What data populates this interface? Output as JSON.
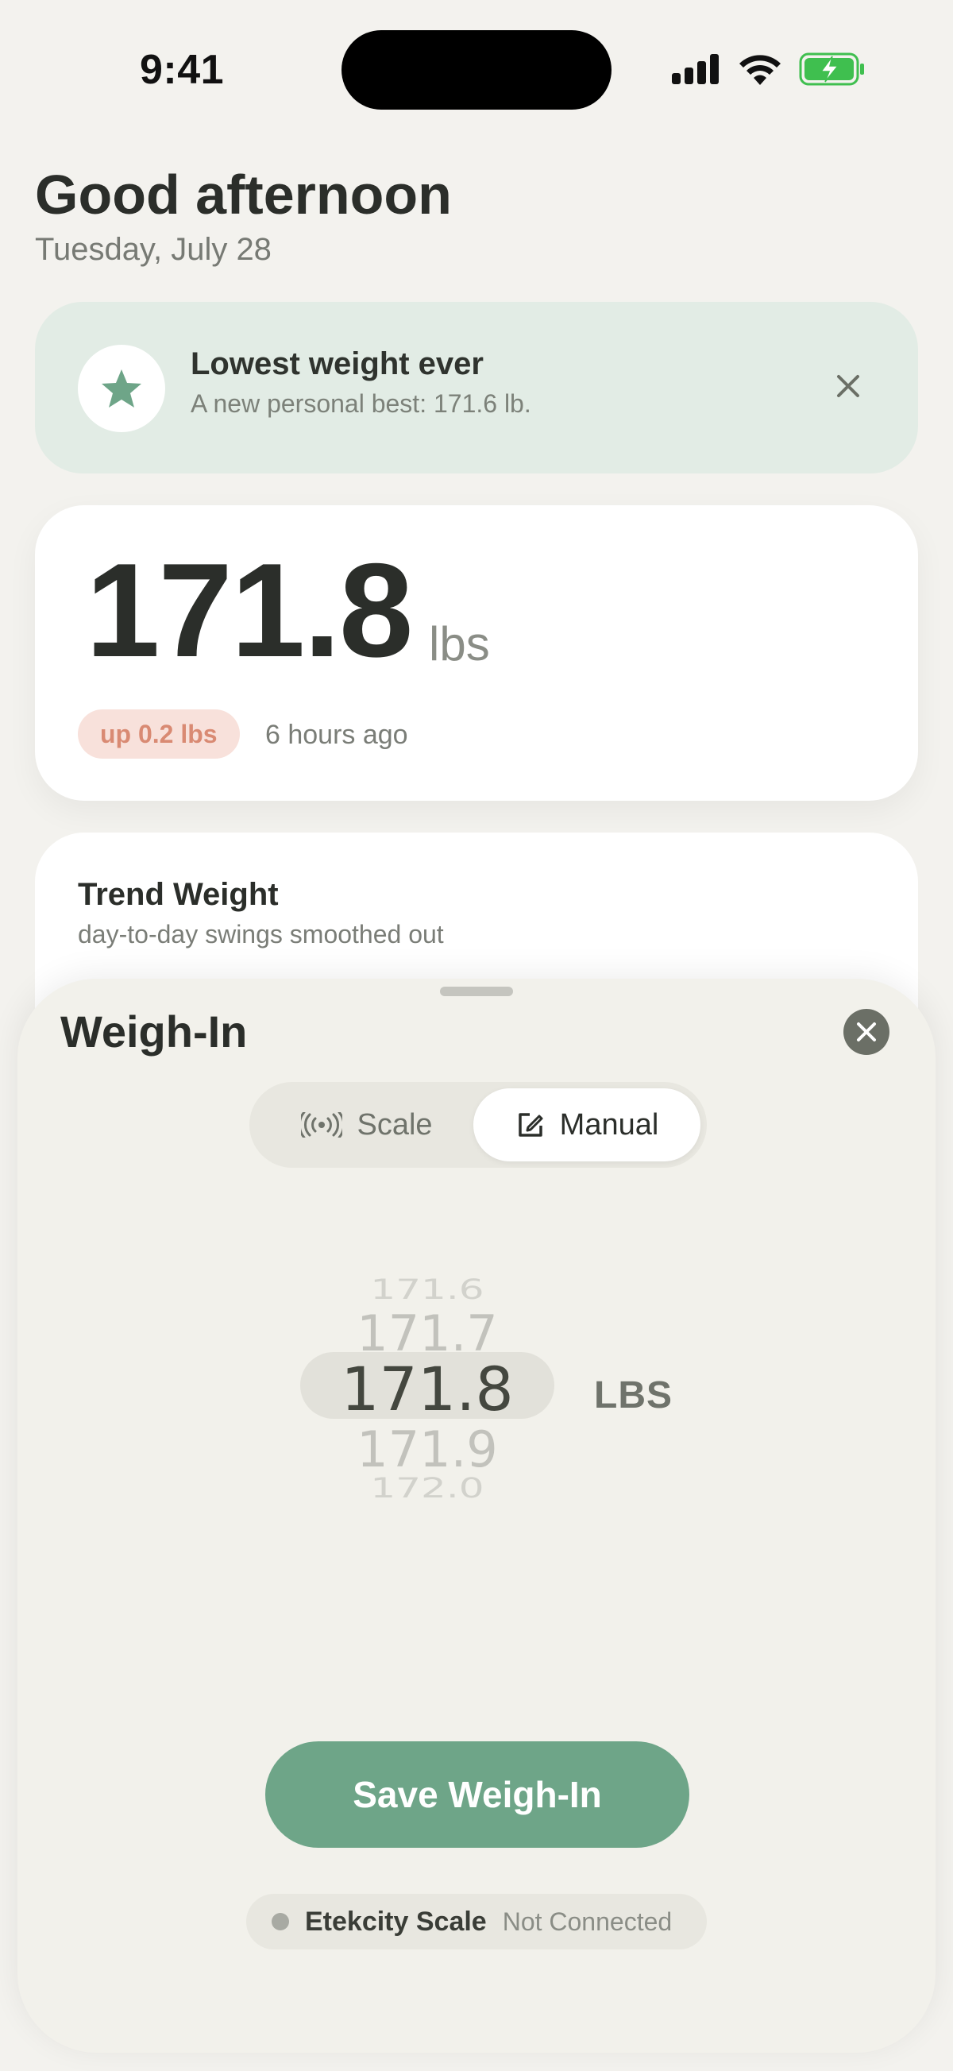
{
  "status_bar": {
    "time": "9:41"
  },
  "header": {
    "greeting": "Good afternoon",
    "date": "Tuesday, July 28"
  },
  "banner": {
    "icon": "star-icon",
    "title": "Lowest weight ever",
    "subtitle": "A new personal best: 171.6 lb."
  },
  "weight_card": {
    "value": "171.8",
    "unit": "lbs",
    "delta": "up 0.2 lbs",
    "time_ago": "6 hours ago"
  },
  "trend_card": {
    "title": "Trend Weight",
    "subtitle": "day-to-day swings smoothed out"
  },
  "sheet": {
    "title": "Weigh-In",
    "tabs": [
      {
        "label": "Scale",
        "icon": "broadcast-icon",
        "selected": false
      },
      {
        "label": "Manual",
        "icon": "edit-icon",
        "selected": true
      }
    ],
    "picker": {
      "values": [
        "171.6",
        "171.7",
        "171.8",
        "171.9",
        "172.0"
      ],
      "selected": "171.8",
      "unit": "LBS"
    },
    "save_label": "Save Weigh-In",
    "device": {
      "name": "Etekcity Scale",
      "status": "Not Connected"
    }
  },
  "colors": {
    "accent": "#6ea588",
    "banner_bg": "#e2ece5",
    "delta_bg": "#f8e1db",
    "delta_text": "#d98a73",
    "background": "#f3f2ee"
  }
}
